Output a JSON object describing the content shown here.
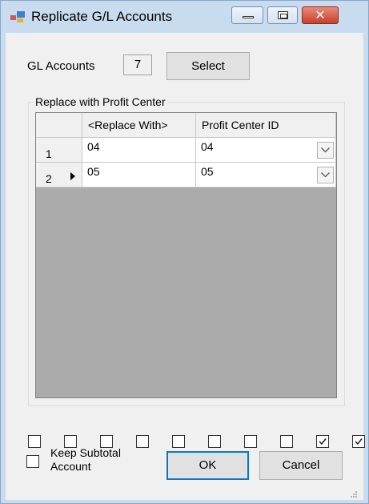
{
  "window": {
    "title": "Replicate G/L Accounts",
    "controls": {
      "minimize": "minimize-icon",
      "maximize": "maximize-icon",
      "close": "close-icon",
      "close_glyph": "✕"
    }
  },
  "gl": {
    "label": "GL Accounts",
    "count": "7",
    "select_label": "Select"
  },
  "group": {
    "label": "Replace with Profit Center"
  },
  "grid": {
    "columns": [
      "<Replace With>",
      "Profit Center ID"
    ],
    "rows": [
      {
        "num": "1",
        "replace_with": "04",
        "profit_center": "04",
        "current": false
      },
      {
        "num": "2",
        "replace_with": "05",
        "profit_center": "05",
        "current": true
      }
    ]
  },
  "checkboxes": [
    false,
    false,
    false,
    false,
    false,
    false,
    false,
    false,
    true,
    true
  ],
  "keep_subtotal": {
    "line1": "Keep Subtotal",
    "line2": "Account",
    "checked": false
  },
  "buttons": {
    "ok": "OK",
    "cancel": "Cancel"
  },
  "colors": {
    "titlebar": "#c9dcef",
    "client": "#f0f0f0",
    "grid_bg": "#ababab",
    "focus_border": "#0078d7",
    "close_button": "#c6402a"
  }
}
